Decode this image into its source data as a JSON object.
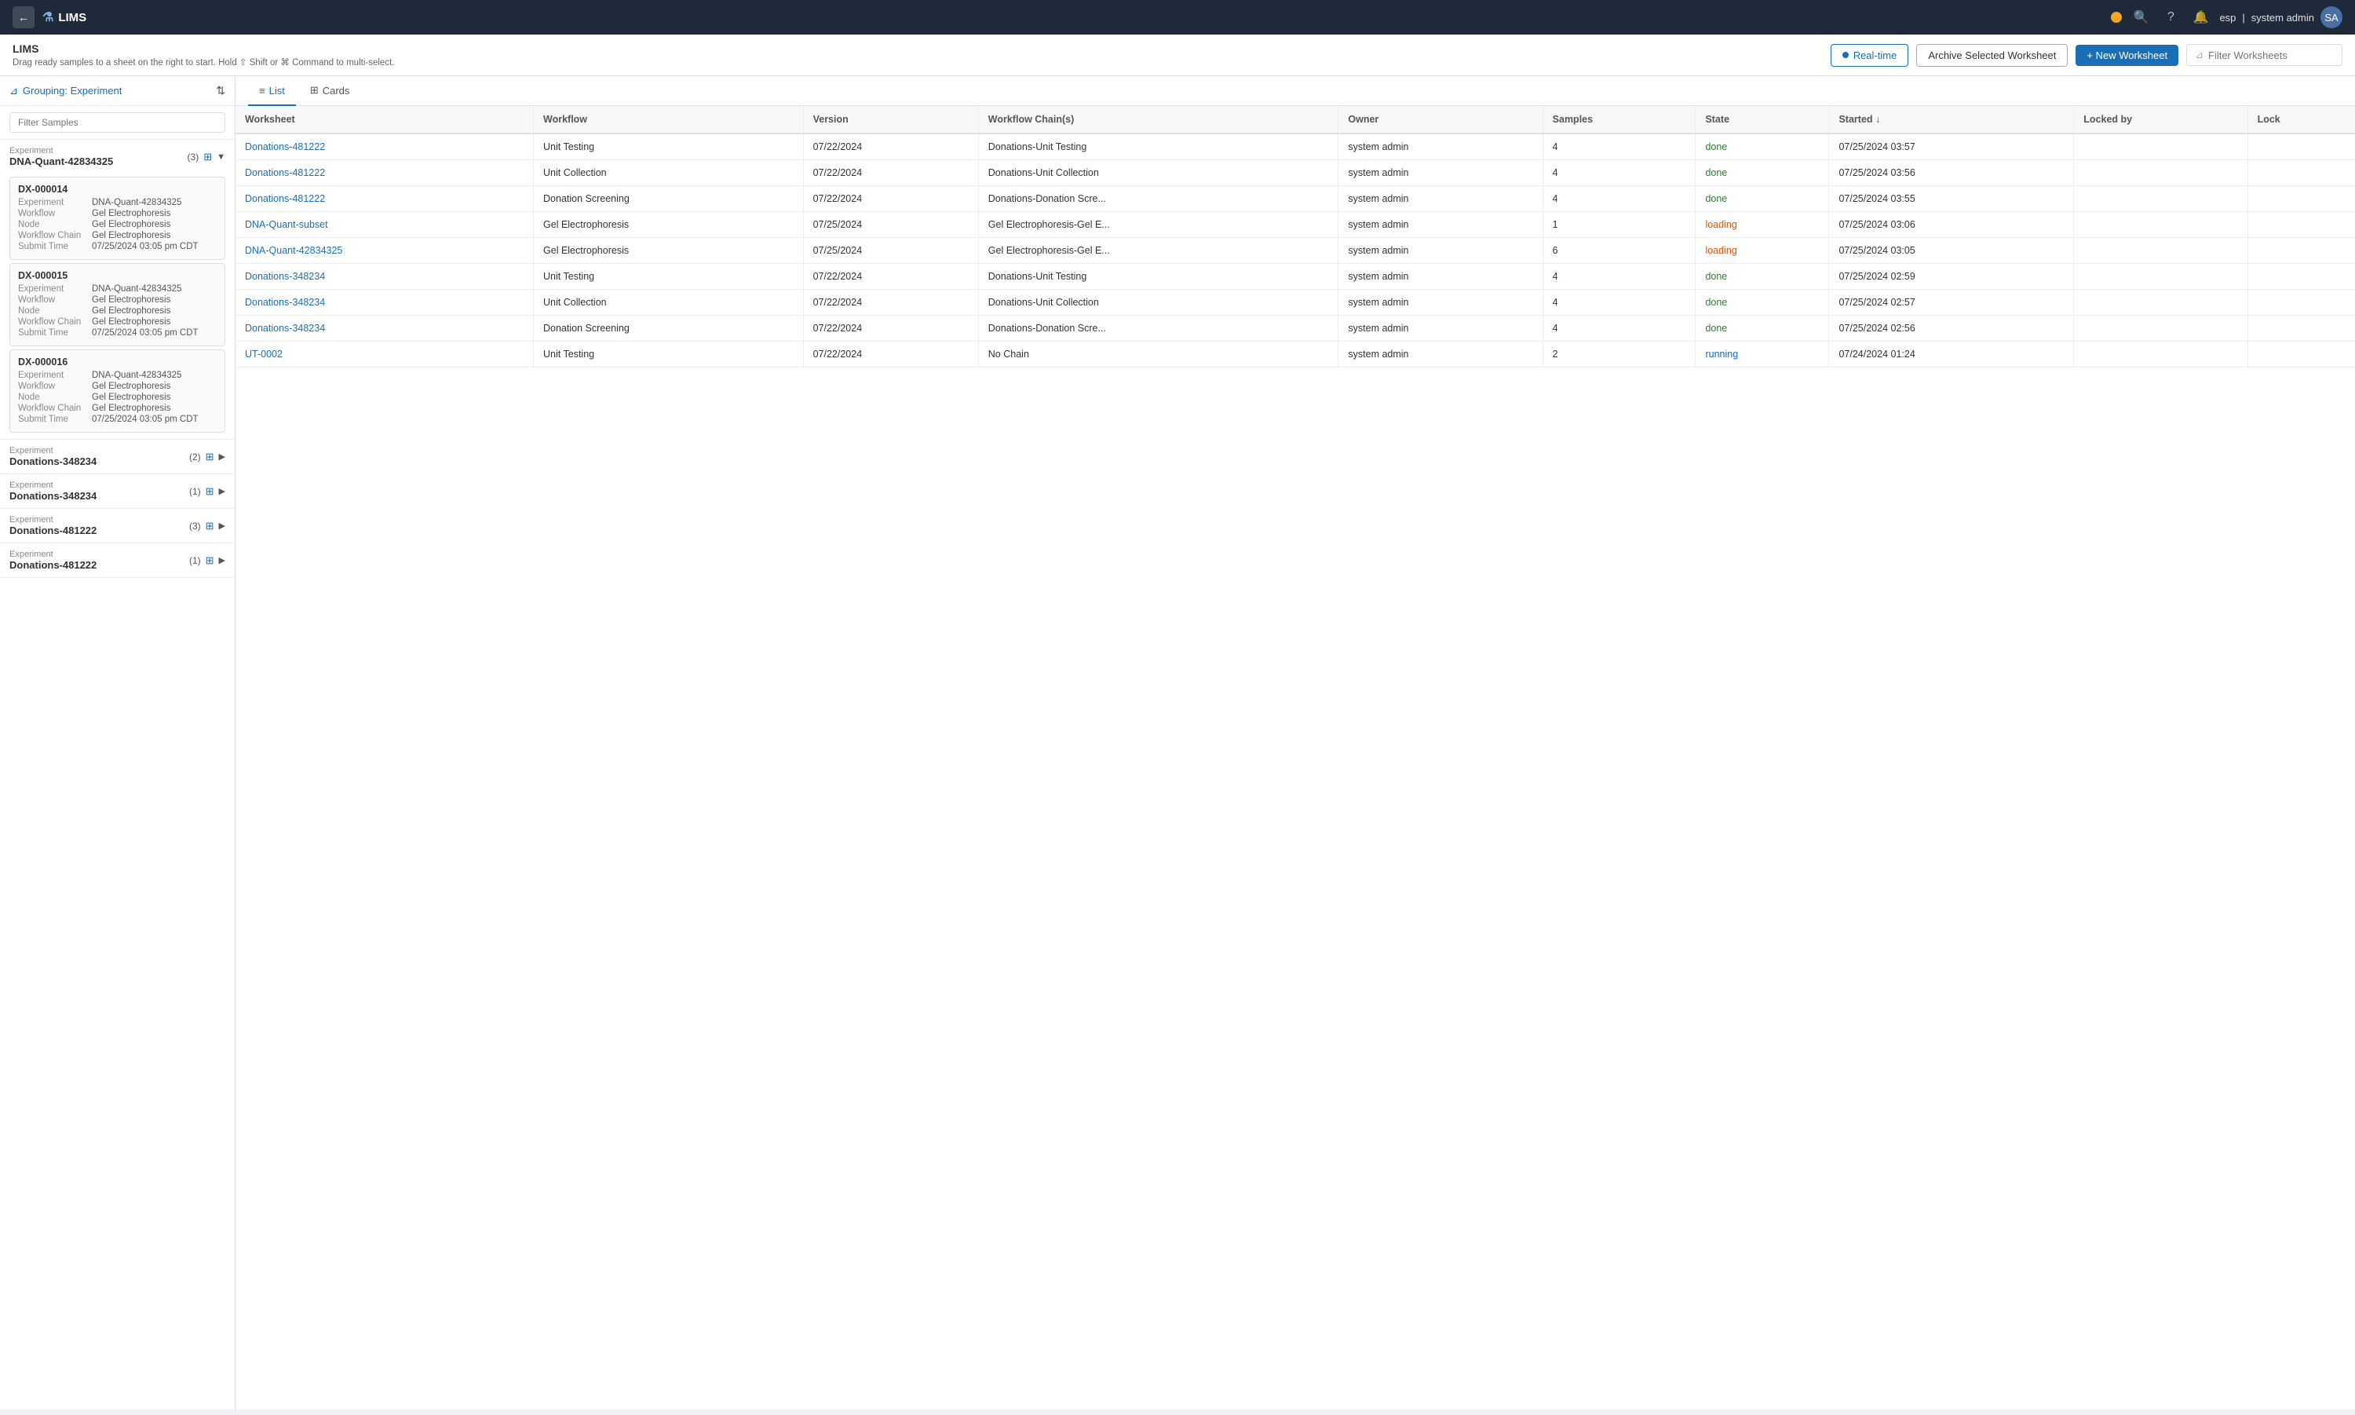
{
  "app": {
    "title": "LIMS",
    "logo_icon": "⚗"
  },
  "nav": {
    "back_label": "←",
    "status_indicator": "orange",
    "search_icon": "🔍",
    "help_icon": "?",
    "bell_icon": "🔔",
    "user_lang": "esp",
    "user_name": "system admin",
    "user_avatar": "SA"
  },
  "page_header": {
    "title": "LIMS",
    "subtitle": "Drag ready samples to a sheet on the right to start. Hold ⇧ Shift or ⌘ Command to multi-select.",
    "realtime_label": "Real-time",
    "archive_label": "Archive Selected Worksheet",
    "new_worksheet_label": "+ New Worksheet",
    "filter_placeholder": "Filter Worksheets"
  },
  "sidebar": {
    "grouping_label": "Grouping: Experiment",
    "filter_placeholder": "Filter Samples",
    "sort_icon": "⇅",
    "experiments": [
      {
        "id": "exp-1",
        "label": "Experiment",
        "name": "DNA-Quant-42834325",
        "count": "(3)",
        "expanded": true,
        "samples": [
          {
            "id": "DX-000014",
            "experiment": "DNA-Quant-42834325",
            "workflow": "Gel Electrophoresis",
            "node": "Gel Electrophoresis",
            "workflow_chain": "Gel Electrophoresis",
            "submit_time": "07/25/2024 03:05 pm CDT"
          },
          {
            "id": "DX-000015",
            "experiment": "DNA-Quant-42834325",
            "workflow": "Gel Electrophoresis",
            "node": "Gel Electrophoresis",
            "workflow_chain": "Gel Electrophoresis",
            "submit_time": "07/25/2024 03:05 pm CDT"
          },
          {
            "id": "DX-000016",
            "experiment": "DNA-Quant-42834325",
            "workflow": "Gel Electrophoresis",
            "node": "Gel Electrophoresis",
            "workflow_chain": "Gel Electrophoresis",
            "submit_time": "07/25/2024 03:05 pm CDT"
          }
        ]
      },
      {
        "id": "exp-2",
        "label": "Experiment",
        "name": "Donations-348234",
        "count": "(2)",
        "expanded": false,
        "samples": []
      },
      {
        "id": "exp-3",
        "label": "Experiment",
        "name": "Donations-348234",
        "count": "(1)",
        "expanded": false,
        "samples": []
      },
      {
        "id": "exp-4",
        "label": "Experiment",
        "name": "Donations-481222",
        "count": "(3)",
        "expanded": false,
        "samples": []
      },
      {
        "id": "exp-5",
        "label": "Experiment",
        "name": "Donations-481222",
        "count": "(1)",
        "expanded": false,
        "samples": []
      }
    ]
  },
  "tabs": [
    {
      "id": "list",
      "label": "List",
      "icon": "≡",
      "active": true
    },
    {
      "id": "cards",
      "label": "Cards",
      "icon": "⊞",
      "active": false
    }
  ],
  "table": {
    "columns": [
      {
        "id": "worksheet",
        "label": "Worksheet"
      },
      {
        "id": "workflow",
        "label": "Workflow"
      },
      {
        "id": "version",
        "label": "Version"
      },
      {
        "id": "workflow_chains",
        "label": "Workflow Chain(s)"
      },
      {
        "id": "owner",
        "label": "Owner"
      },
      {
        "id": "samples",
        "label": "Samples"
      },
      {
        "id": "state",
        "label": "State"
      },
      {
        "id": "started",
        "label": "Started ↓"
      },
      {
        "id": "locked_by",
        "label": "Locked by"
      },
      {
        "id": "lock",
        "label": "Lock"
      }
    ],
    "rows": [
      {
        "worksheet": "Donations-481222",
        "workflow": "Unit Testing",
        "version": "07/22/2024",
        "workflow_chains": "Donations-Unit Testing",
        "owner": "system admin",
        "samples": "4",
        "state": "done",
        "started": "07/25/2024 03:57",
        "locked_by": "",
        "lock": ""
      },
      {
        "worksheet": "Donations-481222",
        "workflow": "Unit Collection",
        "version": "07/22/2024",
        "workflow_chains": "Donations-Unit Collection",
        "owner": "system admin",
        "samples": "4",
        "state": "done",
        "started": "07/25/2024 03:56",
        "locked_by": "",
        "lock": ""
      },
      {
        "worksheet": "Donations-481222",
        "workflow": "Donation Screening",
        "version": "07/22/2024",
        "workflow_chains": "Donations-Donation Scre...",
        "owner": "system admin",
        "samples": "4",
        "state": "done",
        "started": "07/25/2024 03:55",
        "locked_by": "",
        "lock": ""
      },
      {
        "worksheet": "DNA-Quant-subset",
        "workflow": "Gel Electrophoresis",
        "version": "07/25/2024",
        "workflow_chains": "Gel Electrophoresis-Gel E...",
        "owner": "system admin",
        "samples": "1",
        "state": "loading",
        "started": "07/25/2024 03:06",
        "locked_by": "",
        "lock": ""
      },
      {
        "worksheet": "DNA-Quant-42834325",
        "workflow": "Gel Electrophoresis",
        "version": "07/25/2024",
        "workflow_chains": "Gel Electrophoresis-Gel E...",
        "owner": "system admin",
        "samples": "6",
        "state": "loading",
        "started": "07/25/2024 03:05",
        "locked_by": "",
        "lock": ""
      },
      {
        "worksheet": "Donations-348234",
        "workflow": "Unit Testing",
        "version": "07/22/2024",
        "workflow_chains": "Donations-Unit Testing",
        "owner": "system admin",
        "samples": "4",
        "state": "done",
        "started": "07/25/2024 02:59",
        "locked_by": "",
        "lock": ""
      },
      {
        "worksheet": "Donations-348234",
        "workflow": "Unit Collection",
        "version": "07/22/2024",
        "workflow_chains": "Donations-Unit Collection",
        "owner": "system admin",
        "samples": "4",
        "state": "done",
        "started": "07/25/2024 02:57",
        "locked_by": "",
        "lock": ""
      },
      {
        "worksheet": "Donations-348234",
        "workflow": "Donation Screening",
        "version": "07/22/2024",
        "workflow_chains": "Donations-Donation Scre...",
        "owner": "system admin",
        "samples": "4",
        "state": "done",
        "started": "07/25/2024 02:56",
        "locked_by": "",
        "lock": ""
      },
      {
        "worksheet": "UT-0002",
        "workflow": "Unit Testing",
        "version": "07/22/2024",
        "workflow_chains": "No Chain",
        "owner": "system admin",
        "samples": "2",
        "state": "running",
        "started": "07/24/2024 01:24",
        "locked_by": "",
        "lock": ""
      }
    ]
  },
  "colors": {
    "accent": "#1a6eb5",
    "nav_bg": "#1e2a3a",
    "state_done": "#2e7d32",
    "state_loading": "#e65100",
    "state_running": "#1565c0"
  }
}
